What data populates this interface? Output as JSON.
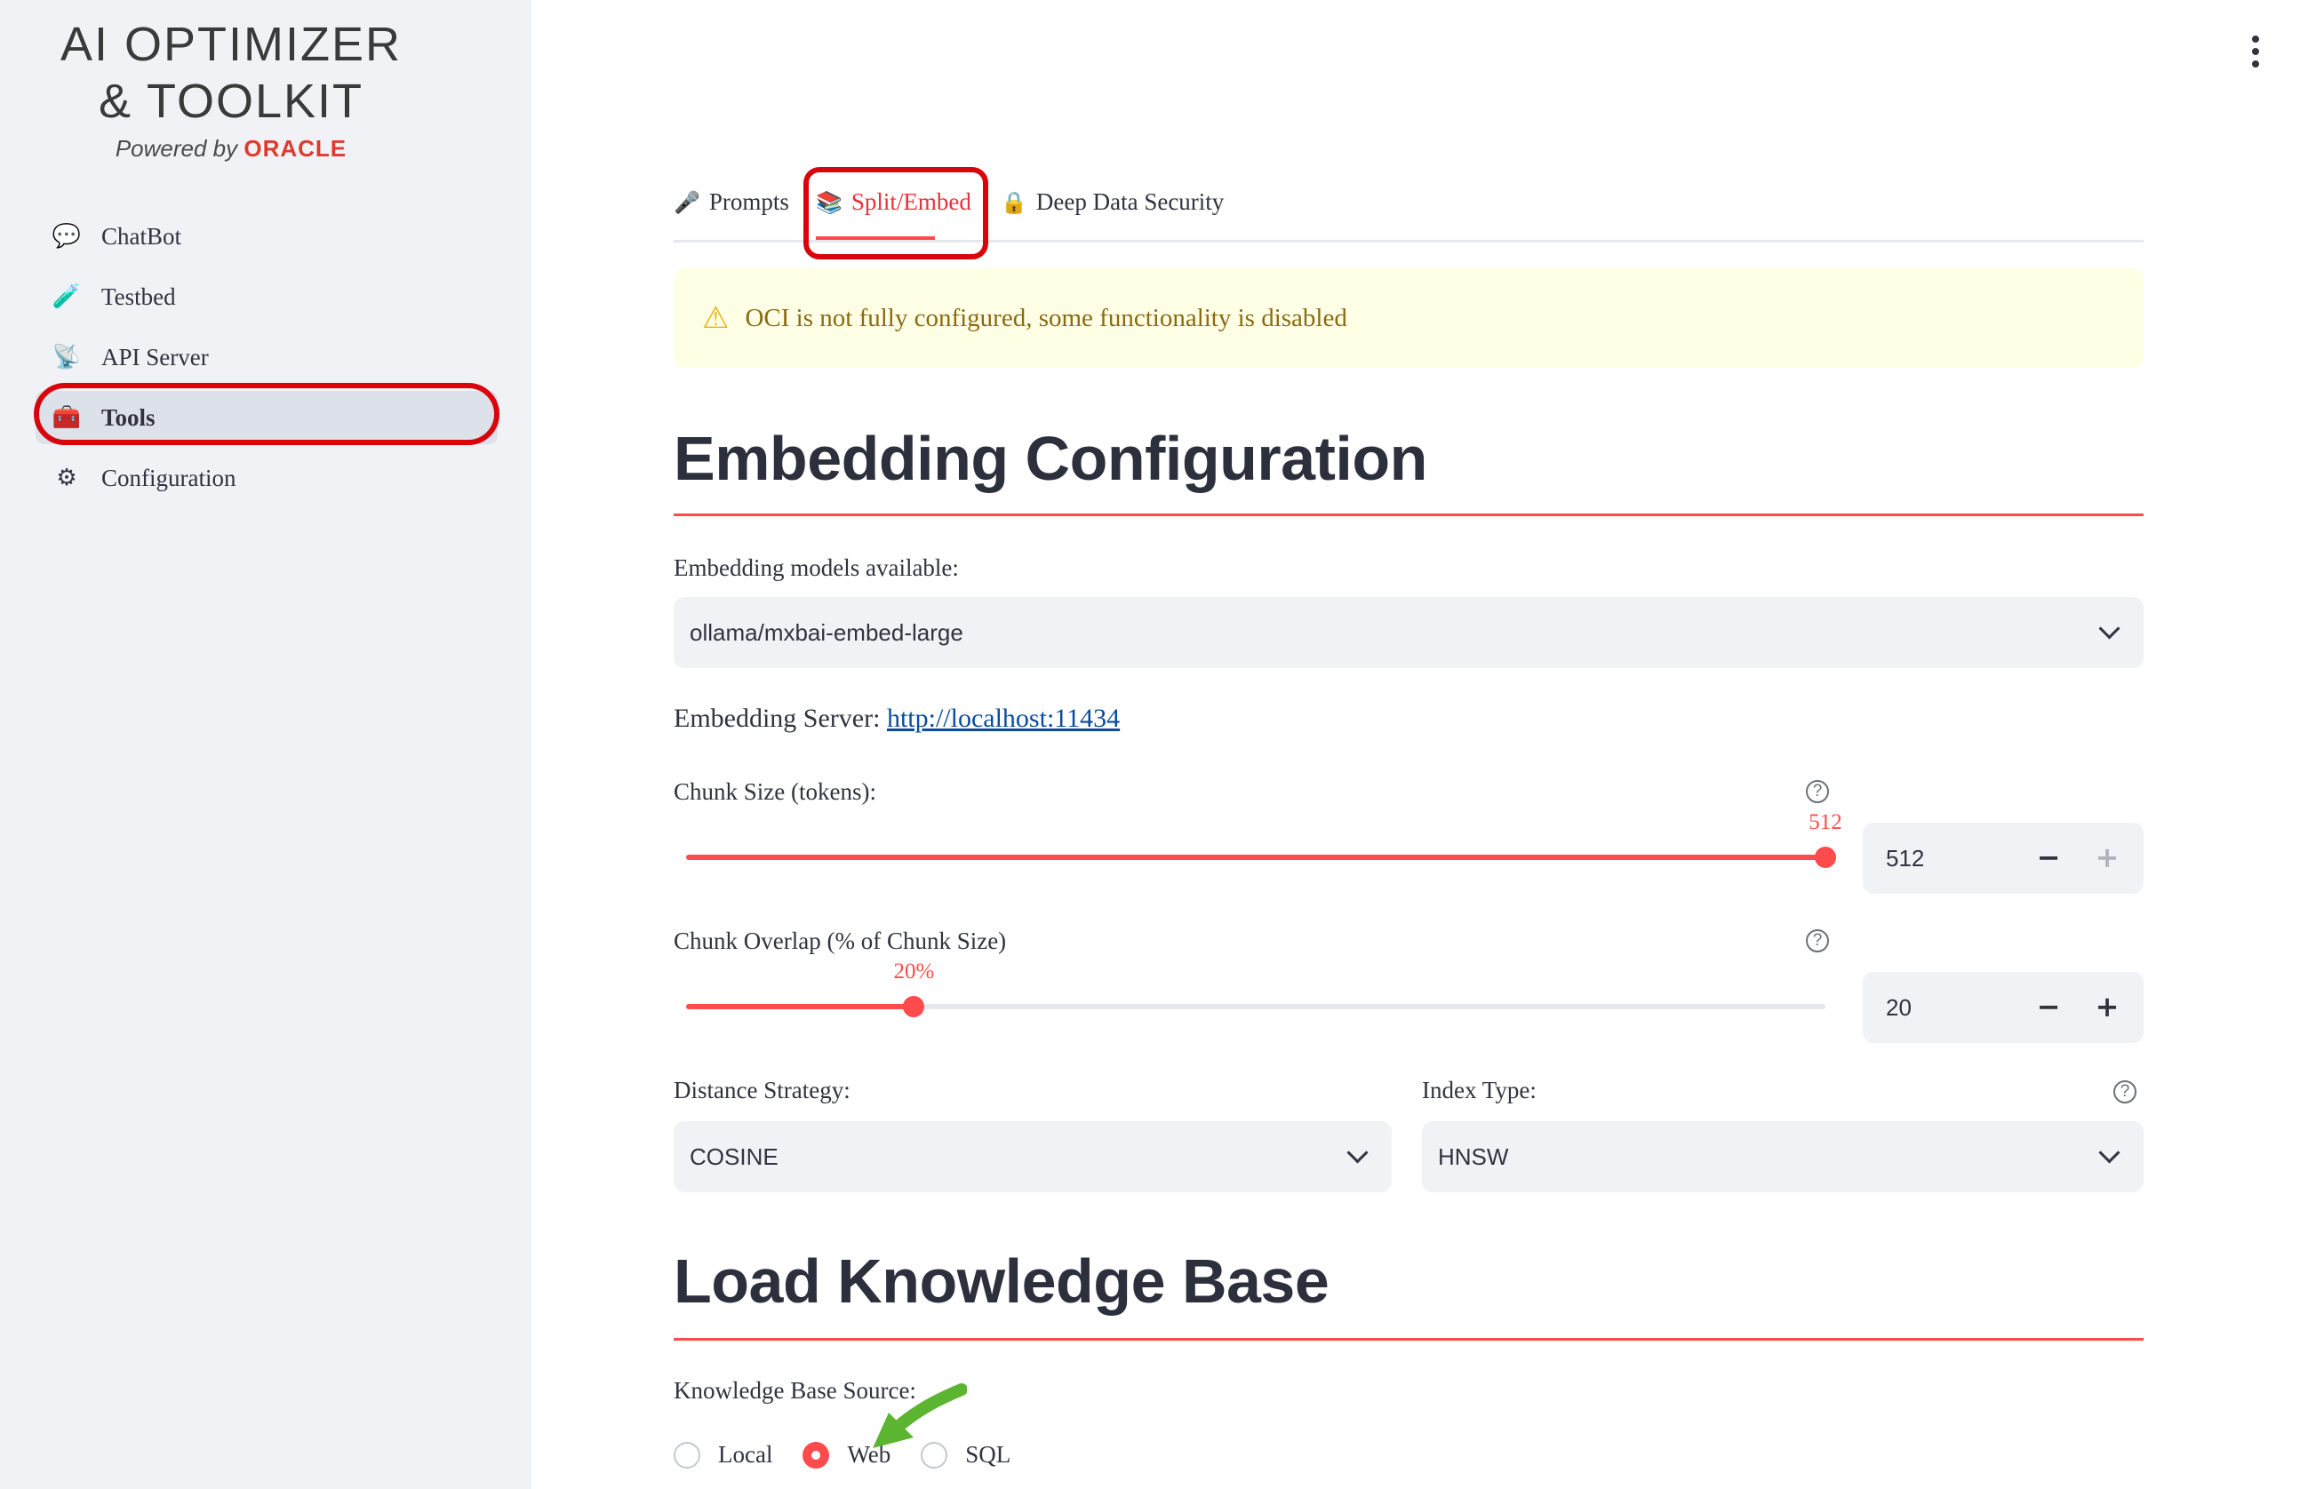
{
  "sidebar": {
    "logo": {
      "line1": "AI OPTIMIZER",
      "line2": "& TOOLKIT",
      "powered_by": "Powered by",
      "brand": "ORACLE"
    },
    "items": [
      {
        "label": "ChatBot",
        "icon": "speech-bubble-icon",
        "glyph": "💬"
      },
      {
        "label": "Testbed",
        "icon": "test-tube-icon",
        "glyph": "🧪"
      },
      {
        "label": "API Server",
        "icon": "satellite-icon",
        "glyph": "📡"
      },
      {
        "label": "Tools",
        "icon": "toolbox-icon",
        "glyph": "🧰"
      },
      {
        "label": "Configuration",
        "icon": "gear-icon",
        "glyph": "⚙"
      }
    ],
    "active": "Tools"
  },
  "tabs": [
    {
      "label": "Prompts",
      "icon": "microphone-icon",
      "glyph": "🎤"
    },
    {
      "label": "Split/Embed",
      "icon": "books-icon",
      "glyph": "📚"
    },
    {
      "label": "Deep Data Security",
      "icon": "lock-icon",
      "glyph": "🔒"
    }
  ],
  "active_tab": "Split/Embed",
  "alert": {
    "icon": "warning-icon",
    "glyph": "⚠",
    "text": "OCI is not fully configured, some functionality is disabled"
  },
  "embedding": {
    "heading": "Embedding Configuration",
    "models_label": "Embedding models available:",
    "model_value": "ollama/mxbai-embed-large",
    "server_label": "Embedding Server:",
    "server_url": "http://localhost:11434",
    "chunk_size": {
      "label": "Chunk Size (tokens):",
      "slider_label": "512",
      "value": "512",
      "fraction": 1.0
    },
    "chunk_overlap": {
      "label": "Chunk Overlap (% of Chunk Size)",
      "slider_label": "20%",
      "value": "20",
      "fraction": 0.2
    },
    "distance_label": "Distance Strategy:",
    "distance_value": "COSINE",
    "index_label": "Index Type:",
    "index_value": "HNSW"
  },
  "knowledge": {
    "heading": "Load Knowledge Base",
    "source_label": "Knowledge Base Source:",
    "options": [
      "Local",
      "Web",
      "SQL"
    ],
    "selected": "Web"
  },
  "colors": {
    "accent": "#ff4b4b",
    "highlight_outline": "#d9050c",
    "annotation_arrow": "#5cb531",
    "sidebar_bg": "#f0f2f6",
    "alert_bg": "#ffffe6"
  }
}
